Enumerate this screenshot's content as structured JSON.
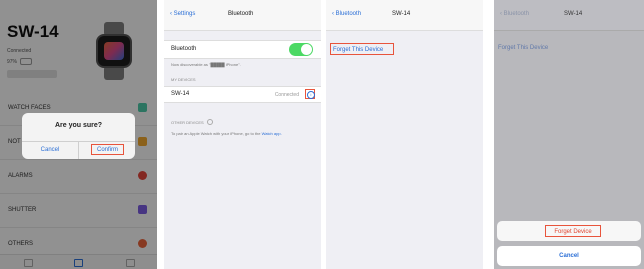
{
  "panel1": {
    "title": "SW-14",
    "status": "Connected",
    "battery": "97%",
    "menu": [
      {
        "label": "WATCH FACES",
        "color": "#4cc9a8"
      },
      {
        "label": "NOT",
        "color": "#f0a830"
      },
      {
        "label": "ALARMS",
        "color": "#e2453c"
      },
      {
        "label": "SHUTTER",
        "color": "#7a5ce0"
      },
      {
        "label": "OTHERS",
        "color": "#e8633a"
      }
    ],
    "alert": {
      "question": "Are you sure?",
      "cancel": "Cancel",
      "confirm": "Confirm"
    }
  },
  "panel2": {
    "back": "Settings",
    "title": "Bluetooth",
    "bluetooth_label": "Bluetooth",
    "bluetooth_on": true,
    "discoverable_note": "Now discoverable as \"█████ iPhone\".",
    "my_devices_header": "MY DEVICES",
    "device": {
      "name": "SW-14",
      "state": "Connected"
    },
    "other_devices_header": "OTHER DEVICES",
    "pair_note": "To pair an Apple Watch with your iPhone, go to the",
    "pair_link": "Watch app."
  },
  "panel3": {
    "back": "Bluetooth",
    "title": "SW-14",
    "forget": "Forget This Device"
  },
  "panel4": {
    "back": "Bluetooth",
    "title": "SW-14",
    "forget_bg": "Forget This Device",
    "sheet_forget": "Forget Device",
    "sheet_cancel": "Cancel"
  },
  "colors": {
    "ios_blue": "#2b6fd6",
    "highlight_red": "#e8543c",
    "toggle_green": "#4cd964"
  }
}
